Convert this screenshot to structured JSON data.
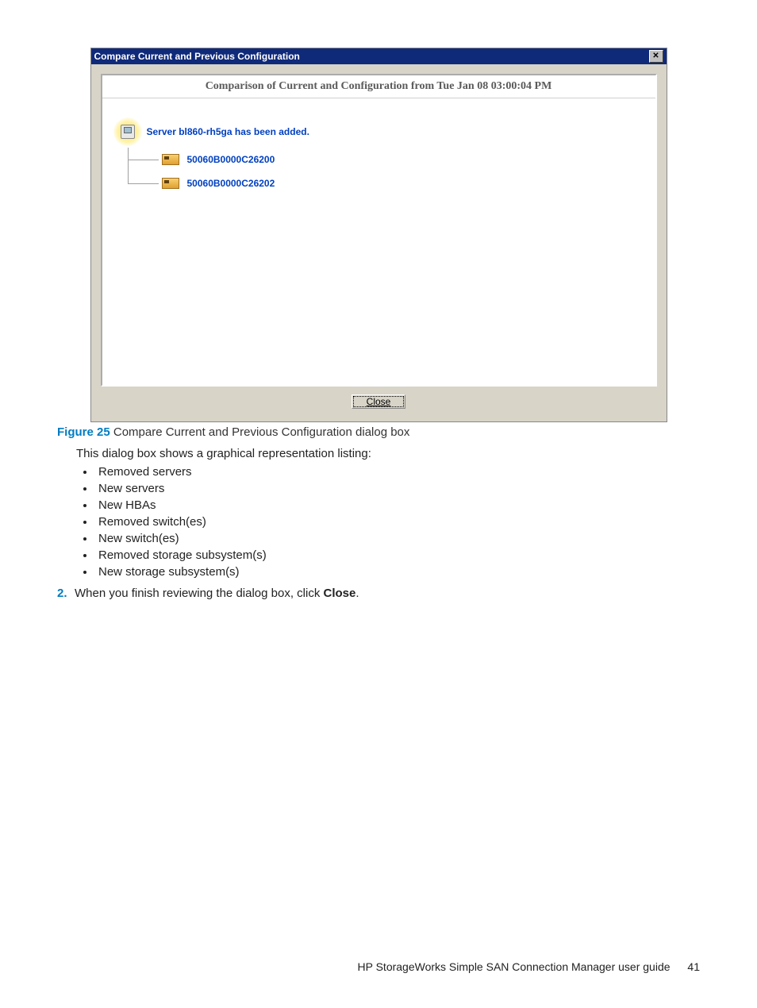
{
  "dialog": {
    "title": "Compare Current and Previous Configuration",
    "panel_header": "Comparison of Current and Configuration from Tue Jan 08 03:00:04 PM",
    "server_line": "Server bl860-rh5ga has been added.",
    "hba1": "50060B0000C26200",
    "hba2": "50060B0000C26202",
    "close_label": "Close"
  },
  "caption": {
    "label": "Figure 25",
    "text": "Compare Current and Previous Configuration dialog box"
  },
  "intro": "This dialog box shows a graphical representation listing:",
  "bullets": [
    "Removed servers",
    "New servers",
    "New HBAs",
    "Removed switch(es)",
    "New switch(es)",
    "Removed storage subsystem(s)",
    "New storage subsystem(s)"
  ],
  "step": {
    "num": "2.",
    "prefix": "When you finish reviewing the dialog box, click ",
    "bold": "Close",
    "suffix": "."
  },
  "footer": {
    "text": "HP StorageWorks Simple SAN Connection Manager user guide",
    "page": "41"
  }
}
